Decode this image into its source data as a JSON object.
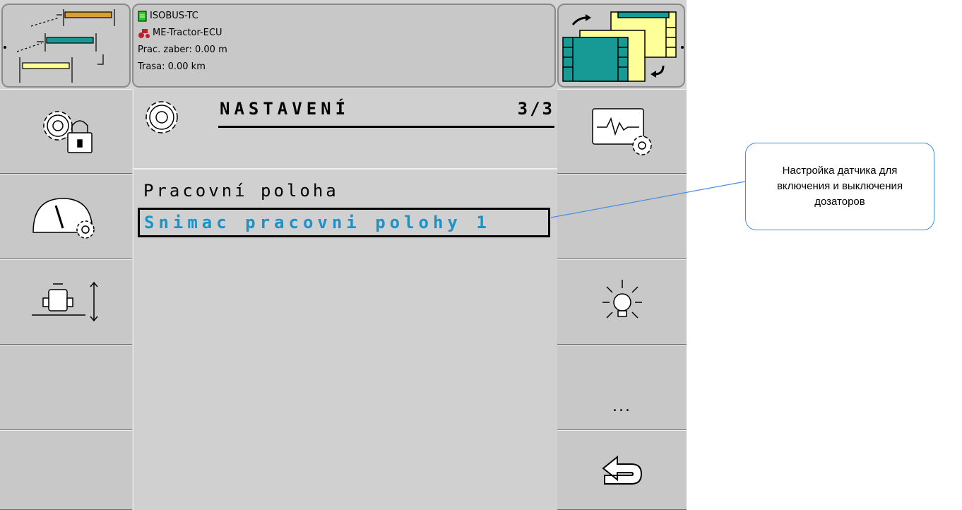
{
  "header": {
    "info_lines": [
      {
        "icon": "document-icon",
        "text": "ISOBUS-TC"
      },
      {
        "icon": "tractor-icon",
        "text": "ME-Tractor-ECU"
      },
      {
        "icon": "",
        "text": "Prac. zaber: 0.00 m"
      },
      {
        "icon": "",
        "text": "Trasa: 0.00 km"
      }
    ]
  },
  "page": {
    "title": "NASTAVENÍ",
    "page_indicator": "3/3",
    "icon": "gear-icon"
  },
  "setting": {
    "label": "Pracovní poloha",
    "value": "Snimac pracovni polohy 1"
  },
  "left_softkeys": [
    "settings-lock-icon",
    "gauge-settings-icon",
    "machine-height-icon",
    "",
    ""
  ],
  "right_softkeys": [
    "diagnostics-icon",
    "",
    "brightness-icon",
    "more-icon",
    "back-icon"
  ],
  "more_label": "...",
  "callout": {
    "text": "Настройка датчика для включения и выключения дозаторов"
  },
  "colors": {
    "accent_value": "#1a93c9",
    "teal": "#179a96",
    "yellow": "#ffff99",
    "orange": "#d4a030",
    "callout_border": "#4a8de0"
  }
}
